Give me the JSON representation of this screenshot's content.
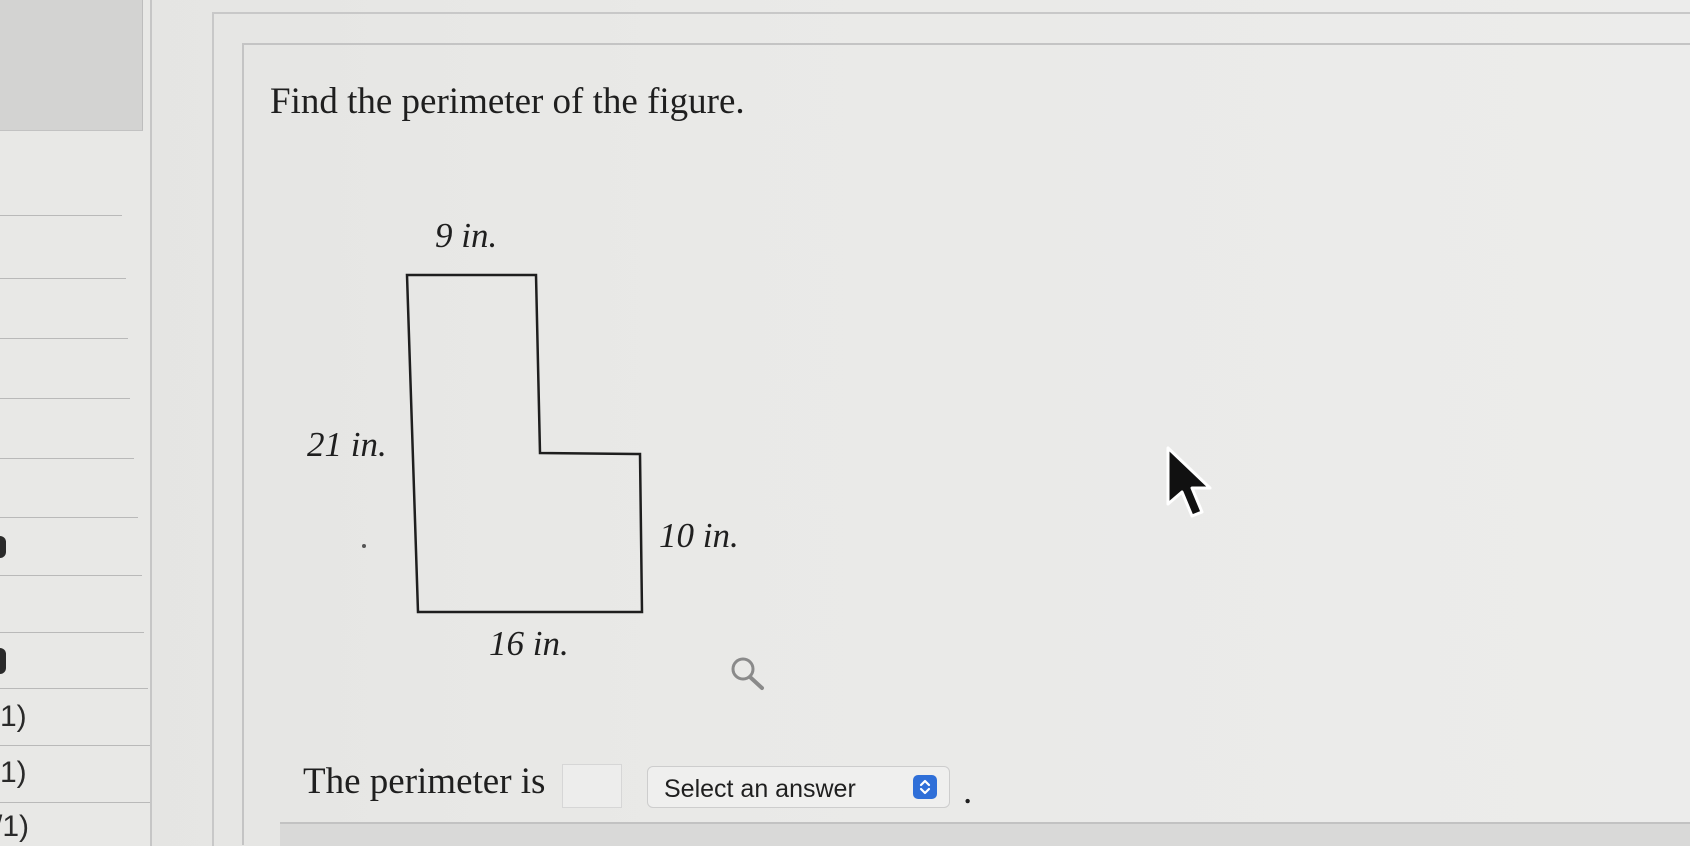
{
  "question": {
    "text": "Find the perimeter of the figure."
  },
  "figure": {
    "shape": "L-shaped polygon",
    "labels": {
      "top": "9 in.",
      "left": "21 in.",
      "right": "10 in.",
      "bottom": "16 in."
    }
  },
  "answer": {
    "prefix": "The perimeter is",
    "input_value": "",
    "select_value": "Select an answer",
    "suffix": "."
  },
  "sidebar": {
    "labels": [
      "1)",
      "1)",
      "/1)"
    ]
  },
  "icons": {
    "search": "magnifier-icon",
    "select": "up-down-chevron-icon",
    "cursor": "arrow-cursor"
  },
  "colors": {
    "select_accent": "#2f6fd8"
  }
}
